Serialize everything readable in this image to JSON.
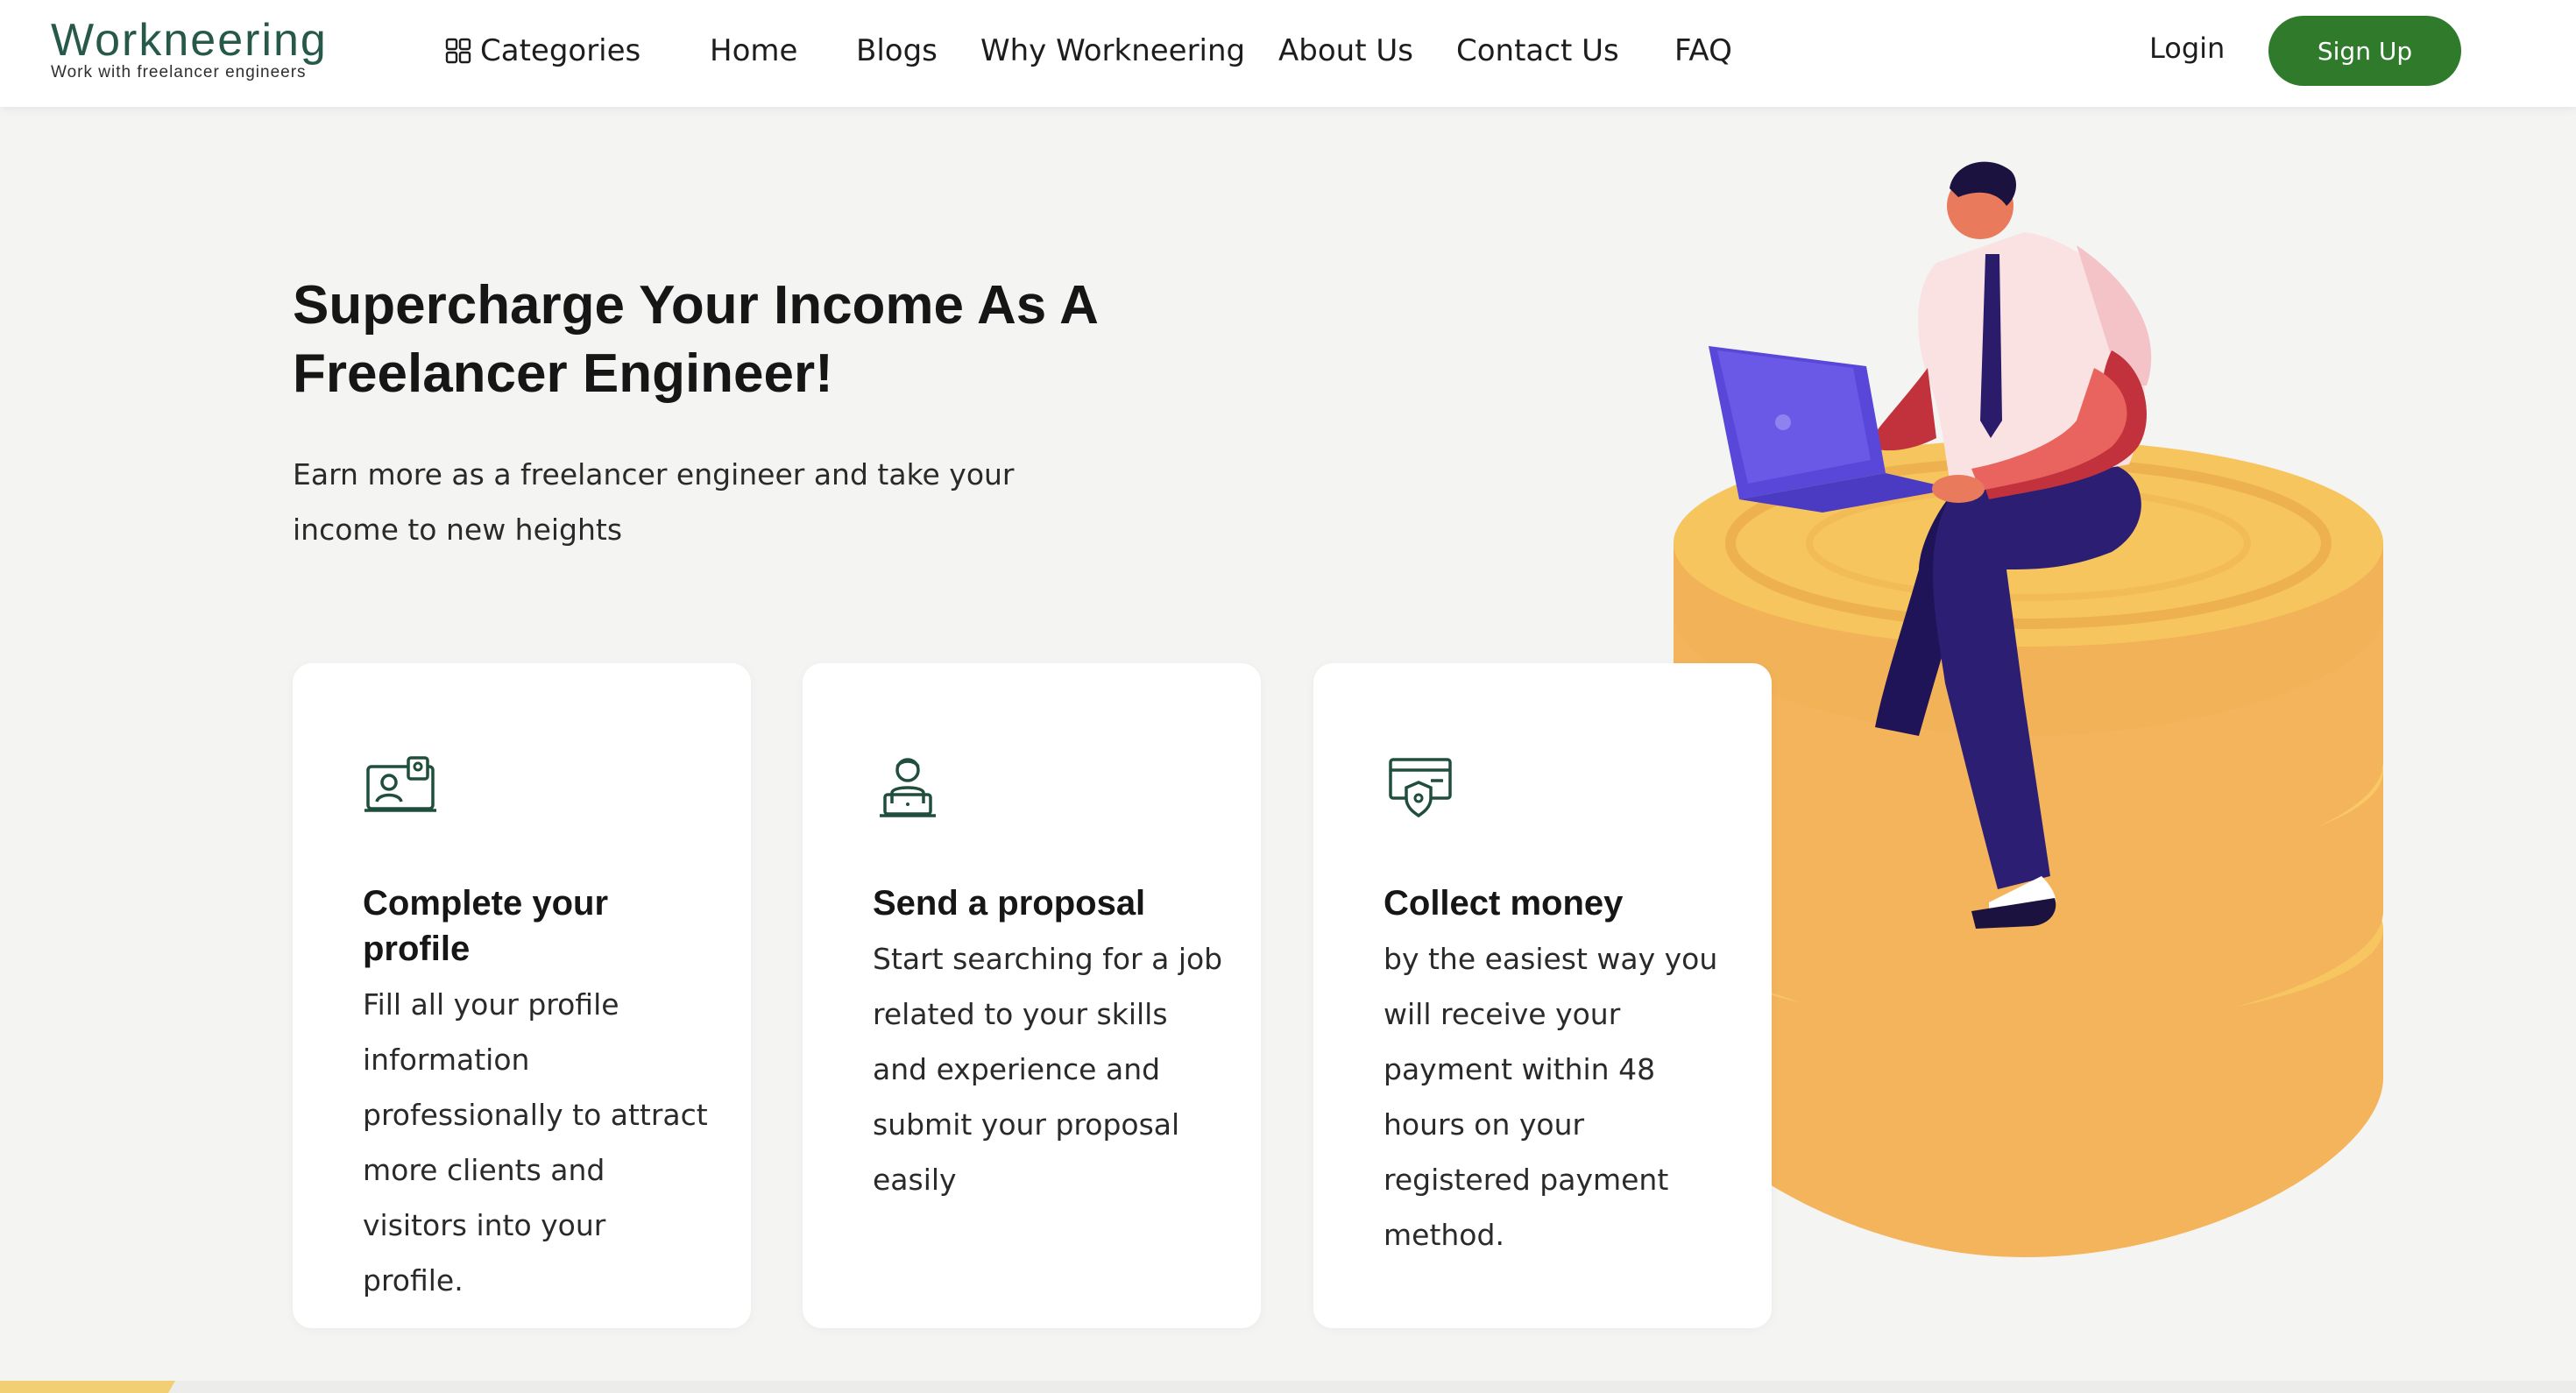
{
  "brand": {
    "name": "Workneering",
    "tagline": "Work with freelancer engineers",
    "accent_color": "#26594a",
    "cta_color": "#2f7a2b"
  },
  "nav": {
    "categories": "Categories",
    "home": "Home",
    "blogs": "Blogs",
    "why": "Why Workneering",
    "about": "About Us",
    "contact": "Contact Us",
    "faq": "FAQ"
  },
  "auth": {
    "login": "Login",
    "signup": "Sign Up"
  },
  "hero": {
    "title": "Supercharge Your Income As A Freelancer Engineer!",
    "subtitle": "Earn more as a freelancer engineer and take your income to new heights",
    "illustration": "man-with-laptop-sitting-on-coin-stack"
  },
  "cards": [
    {
      "icon": "profile-card-icon",
      "title": "Complete your profile",
      "text": "Fill all your profile information professionally to attract more clients and visitors into your profile."
    },
    {
      "icon": "person-laptop-icon",
      "title": "Send a proposal",
      "text": "Start searching for a job related to your skills and experience and submit your proposal easily"
    },
    {
      "icon": "payment-shield-icon",
      "title": "Collect money",
      "text": "by the easiest way you will receive your payment within 48 hours on your registered payment method."
    }
  ]
}
